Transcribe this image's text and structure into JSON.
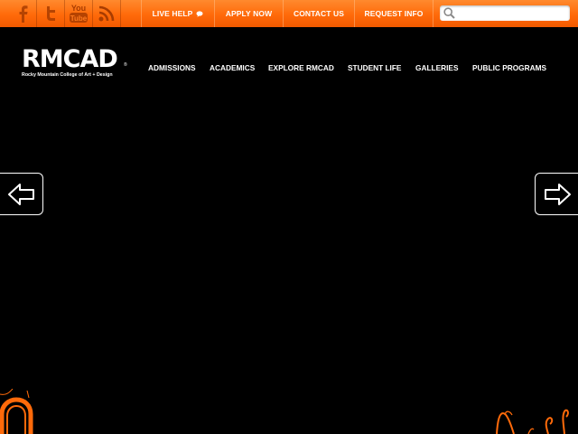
{
  "topbar": {
    "social": [
      {
        "name": "facebook-icon",
        "label": "f"
      },
      {
        "name": "twitter-icon",
        "label": "t"
      },
      {
        "name": "youtube-icon",
        "label": "You Tube"
      },
      {
        "name": "rss-icon",
        "label": ""
      }
    ],
    "links": {
      "live_help": "LIVE HELP",
      "apply_now": "APPLY NOW",
      "contact_us": "CONTACT US",
      "request_info": "REQUEST INFO"
    },
    "search": {
      "value": "",
      "placeholder": ""
    },
    "colors": {
      "accent": "#ff6a0a",
      "background": "#000000",
      "text": "#ffffff"
    }
  },
  "header": {
    "logo_text": "RMCAD",
    "logo_registered": "®",
    "logo_subtitle": "Rocky Mountain College of Art + Design",
    "nav": {
      "admissions": "ADMISSIONS",
      "academics": "ACADEMICS",
      "explore": "EXPLORE RMCAD",
      "student_life": "STUDENT LIFE",
      "galleries": "GALLERIES",
      "public_programs": "PUBLIC PROGRAMS"
    }
  },
  "slider": {
    "prev_icon": "arrow-left-icon",
    "next_icon": "arrow-right-icon"
  }
}
